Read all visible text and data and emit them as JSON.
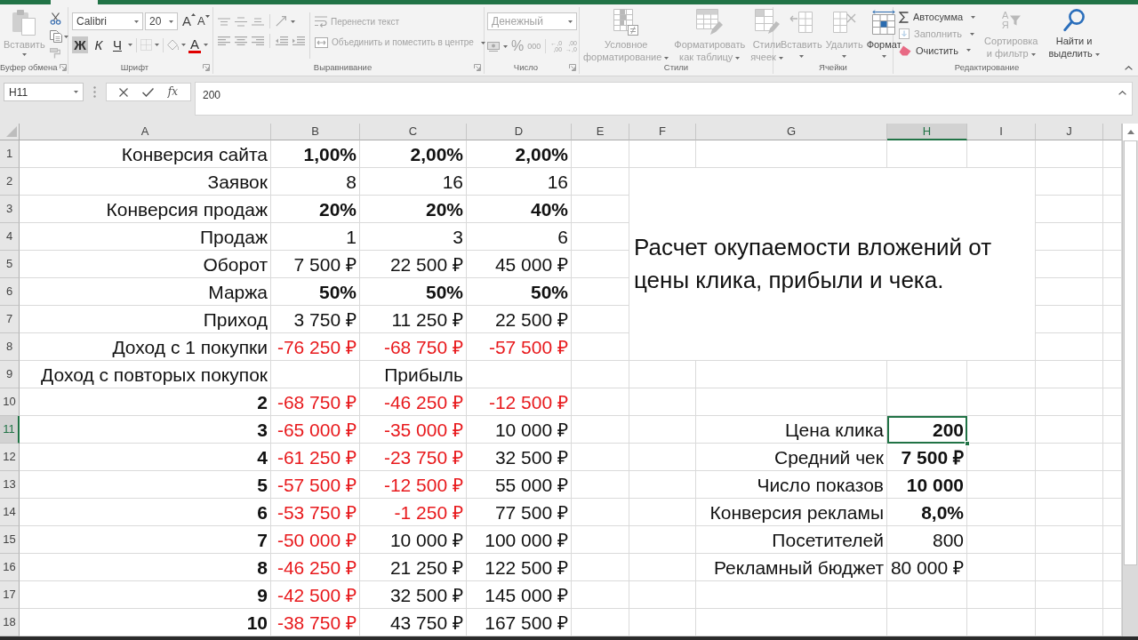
{
  "ribbon": {
    "clipboard": {
      "label": "Буфер обмена",
      "paste": {
        "label": "Вставить",
        "disabled": true
      }
    },
    "font": {
      "label": "Шрифт",
      "font_name": "Calibri",
      "font_size": "20",
      "grow_font": "A",
      "shrink_font": "A",
      "styles": [
        {
          "kind": "bold",
          "label": "Ж",
          "selected": true
        },
        {
          "kind": "italic",
          "label": "К",
          "selected": false
        },
        {
          "kind": "underline",
          "label": "Ч",
          "selected": false
        }
      ],
      "font_color": "A"
    },
    "alignment": {
      "label": "Выравнивание",
      "wrap_text": {
        "label": "Перенести текст",
        "disabled": true
      },
      "merge": {
        "label": "Объединить и поместить в центре",
        "disabled": true
      }
    },
    "number": {
      "label": "Число",
      "format": {
        "value": "Денежный",
        "disabled": true
      },
      "percent": "%",
      "thousands": "000",
      "increase_decimal": [
        "←,0",
        ",00"
      ],
      "decrease_decimal": [
        ",00",
        "→,0"
      ]
    },
    "styles": {
      "label": "Стили",
      "buttons": [
        {
          "kind": "conditional",
          "lines": [
            "Условное",
            "форматирование"
          ],
          "disabled": true
        },
        {
          "kind": "table",
          "lines": [
            "Форматировать",
            "как таблицу"
          ],
          "disabled": true
        },
        {
          "kind": "styles",
          "lines": [
            "Стили",
            "ячеек"
          ],
          "disabled": true
        }
      ]
    },
    "cells": {
      "label": "Ячейки",
      "buttons": [
        {
          "kind": "insert",
          "lines": [
            "Вставить"
          ],
          "disabled": true
        },
        {
          "kind": "delete",
          "lines": [
            "Удалить"
          ],
          "disabled": true
        },
        {
          "kind": "format",
          "lines": [
            "Формат"
          ],
          "disabled": false
        }
      ]
    },
    "editing": {
      "label": "Редактирование",
      "small_buttons": [
        {
          "kind": "autosum",
          "label": "Автосумма",
          "disabled": false
        },
        {
          "kind": "fill",
          "label": "Заполнить",
          "disabled": true
        },
        {
          "kind": "clear",
          "label": "Очистить",
          "disabled": false
        }
      ],
      "buttons": [
        {
          "kind": "sort",
          "glyphs": [
            "А",
            "Я"
          ],
          "lines": [
            "Сортировка",
            "и фильтр"
          ],
          "disabled": true
        },
        {
          "kind": "find",
          "lines": [
            "Найти и",
            "выделить"
          ],
          "disabled": false
        }
      ]
    }
  },
  "formula_bar": {
    "name_box": "H11",
    "function_label": "fx",
    "value": "200"
  },
  "sheet": {
    "columns": [
      {
        "label": "A",
        "selected": false
      },
      {
        "label": "B",
        "selected": false
      },
      {
        "label": "C",
        "selected": false
      },
      {
        "label": "D",
        "selected": false
      },
      {
        "label": "E",
        "selected": false
      },
      {
        "label": "F",
        "selected": false
      },
      {
        "label": "G",
        "selected": false
      },
      {
        "label": "H",
        "selected": true
      },
      {
        "label": "I",
        "selected": false
      },
      {
        "label": "J",
        "selected": false
      }
    ],
    "rows": [
      {
        "label": "1",
        "selected": false
      },
      {
        "label": "2",
        "selected": false
      },
      {
        "label": "3",
        "selected": false
      },
      {
        "label": "4",
        "selected": false
      },
      {
        "label": "5",
        "selected": false
      },
      {
        "label": "6",
        "selected": false
      },
      {
        "label": "7",
        "selected": false
      },
      {
        "label": "8",
        "selected": false
      },
      {
        "label": "9",
        "selected": false
      },
      {
        "label": "10",
        "selected": false
      },
      {
        "label": "11",
        "selected": true
      },
      {
        "label": "12",
        "selected": false
      },
      {
        "label": "13",
        "selected": false
      },
      {
        "label": "14",
        "selected": false
      },
      {
        "label": "15",
        "selected": false
      },
      {
        "label": "16",
        "selected": false
      },
      {
        "label": "17",
        "selected": false
      },
      {
        "label": "18",
        "selected": false
      }
    ],
    "calc_table": [
      {
        "name": {
          "text": "Конверсия сайта",
          "bold": false,
          "negative": false,
          "selected": false
        },
        "values": [
          {
            "text": "1,00%",
            "bold": true,
            "negative": false,
            "selected": false
          },
          {
            "text": "2,00%",
            "bold": true,
            "negative": false,
            "selected": false
          },
          {
            "text": "2,00%",
            "bold": true,
            "negative": false,
            "selected": false
          }
        ]
      },
      {
        "name": {
          "text": "Заявок",
          "bold": false,
          "negative": false,
          "selected": false
        },
        "values": [
          {
            "text": "8",
            "bold": false,
            "negative": false,
            "selected": false
          },
          {
            "text": "16",
            "bold": false,
            "negative": false,
            "selected": false
          },
          {
            "text": "16",
            "bold": false,
            "negative": false,
            "selected": false
          }
        ]
      },
      {
        "name": {
          "text": "Конверсия продаж",
          "bold": false,
          "negative": false,
          "selected": false
        },
        "values": [
          {
            "text": "20%",
            "bold": true,
            "negative": false,
            "selected": false
          },
          {
            "text": "20%",
            "bold": true,
            "negative": false,
            "selected": false
          },
          {
            "text": "40%",
            "bold": true,
            "negative": false,
            "selected": false
          }
        ]
      },
      {
        "name": {
          "text": "Продаж",
          "bold": false,
          "negative": false,
          "selected": false
        },
        "values": [
          {
            "text": "1",
            "bold": false,
            "negative": false,
            "selected": false
          },
          {
            "text": "3",
            "bold": false,
            "negative": false,
            "selected": false
          },
          {
            "text": "6",
            "bold": false,
            "negative": false,
            "selected": false
          }
        ]
      },
      {
        "name": {
          "text": "Оборот",
          "bold": false,
          "negative": false,
          "selected": false
        },
        "values": [
          {
            "text": "7 500 ₽",
            "bold": false,
            "negative": false,
            "selected": false
          },
          {
            "text": "22 500 ₽",
            "bold": false,
            "negative": false,
            "selected": false
          },
          {
            "text": "45 000 ₽",
            "bold": false,
            "negative": false,
            "selected": false
          }
        ]
      },
      {
        "name": {
          "text": "Маржа",
          "bold": false,
          "negative": false,
          "selected": false
        },
        "values": [
          {
            "text": "50%",
            "bold": true,
            "negative": false,
            "selected": false
          },
          {
            "text": "50%",
            "bold": true,
            "negative": false,
            "selected": false
          },
          {
            "text": "50%",
            "bold": true,
            "negative": false,
            "selected": false
          }
        ]
      },
      {
        "name": {
          "text": "Приход",
          "bold": false,
          "negative": false,
          "selected": false
        },
        "values": [
          {
            "text": "3 750 ₽",
            "bold": false,
            "negative": false,
            "selected": false
          },
          {
            "text": "11 250 ₽",
            "bold": false,
            "negative": false,
            "selected": false
          },
          {
            "text": "22 500 ₽",
            "bold": false,
            "negative": false,
            "selected": false
          }
        ]
      },
      {
        "name": {
          "text": "Доход с 1 покупки",
          "bold": false,
          "negative": false,
          "selected": false
        },
        "values": [
          {
            "text": "-76 250 ₽",
            "bold": false,
            "negative": true,
            "selected": false
          },
          {
            "text": "-68 750 ₽",
            "bold": false,
            "negative": true,
            "selected": false
          },
          {
            "text": "-57 500 ₽",
            "bold": false,
            "negative": true,
            "selected": false
          }
        ]
      },
      {
        "name": {
          "text": "Доход с повторых покупок",
          "bold": false,
          "negative": false,
          "selected": false
        },
        "heading": {
          "text": "Прибыль",
          "bold": false,
          "negative": false,
          "selected": false
        }
      },
      {
        "name": {
          "text": "2",
          "bold": true,
          "negative": false,
          "selected": false
        },
        "values": [
          {
            "text": "-68 750 ₽",
            "bold": false,
            "negative": true,
            "selected": false
          },
          {
            "text": "-46 250 ₽",
            "bold": false,
            "negative": true,
            "selected": false
          },
          {
            "text": "-12 500 ₽",
            "bold": false,
            "negative": true,
            "selected": false
          }
        ]
      },
      {
        "name": {
          "text": "3",
          "bold": true,
          "negative": false,
          "selected": false
        },
        "values": [
          {
            "text": "-65 000 ₽",
            "bold": false,
            "negative": true,
            "selected": false
          },
          {
            "text": "-35 000 ₽",
            "bold": false,
            "negative": true,
            "selected": false
          },
          {
            "text": "10 000 ₽",
            "bold": false,
            "negative": false,
            "selected": false
          }
        ]
      },
      {
        "name": {
          "text": "4",
          "bold": true,
          "negative": false,
          "selected": false
        },
        "values": [
          {
            "text": "-61 250 ₽",
            "bold": false,
            "negative": true,
            "selected": false
          },
          {
            "text": "-23 750 ₽",
            "bold": false,
            "negative": true,
            "selected": false
          },
          {
            "text": "32 500 ₽",
            "bold": false,
            "negative": false,
            "selected": false
          }
        ]
      },
      {
        "name": {
          "text": "5",
          "bold": true,
          "negative": false,
          "selected": false
        },
        "values": [
          {
            "text": "-57 500 ₽",
            "bold": false,
            "negative": true,
            "selected": false
          },
          {
            "text": "-12 500 ₽",
            "bold": false,
            "negative": true,
            "selected": false
          },
          {
            "text": "55 000 ₽",
            "bold": false,
            "negative": false,
            "selected": false
          }
        ]
      },
      {
        "name": {
          "text": "6",
          "bold": true,
          "negative": false,
          "selected": false
        },
        "values": [
          {
            "text": "-53 750 ₽",
            "bold": false,
            "negative": true,
            "selected": false
          },
          {
            "text": "-1 250 ₽",
            "bold": false,
            "negative": true,
            "selected": false
          },
          {
            "text": "77 500 ₽",
            "bold": false,
            "negative": false,
            "selected": false
          }
        ]
      },
      {
        "name": {
          "text": "7",
          "bold": true,
          "negative": false,
          "selected": false
        },
        "values": [
          {
            "text": "-50 000 ₽",
            "bold": false,
            "negative": true,
            "selected": false
          },
          {
            "text": "10 000 ₽",
            "bold": false,
            "negative": false,
            "selected": false
          },
          {
            "text": "100 000 ₽",
            "bold": false,
            "negative": false,
            "selected": false
          }
        ]
      },
      {
        "name": {
          "text": "8",
          "bold": true,
          "negative": false,
          "selected": false
        },
        "values": [
          {
            "text": "-46 250 ₽",
            "bold": false,
            "negative": true,
            "selected": false
          },
          {
            "text": "21 250 ₽",
            "bold": false,
            "negative": false,
            "selected": false
          },
          {
            "text": "122 500 ₽",
            "bold": false,
            "negative": false,
            "selected": false
          }
        ]
      },
      {
        "name": {
          "text": "9",
          "bold": true,
          "negative": false,
          "selected": false
        },
        "values": [
          {
            "text": "-42 500 ₽",
            "bold": false,
            "negative": true,
            "selected": false
          },
          {
            "text": "32 500 ₽",
            "bold": false,
            "negative": false,
            "selected": false
          },
          {
            "text": "145 000 ₽",
            "bold": false,
            "negative": false,
            "selected": false
          }
        ]
      },
      {
        "name": {
          "text": "10",
          "bold": true,
          "negative": false,
          "selected": false
        },
        "values": [
          {
            "text": "-38 750 ₽",
            "bold": false,
            "negative": true,
            "selected": false
          },
          {
            "text": "43 750 ₽",
            "bold": false,
            "negative": false,
            "selected": false
          },
          {
            "text": "167 500 ₽",
            "bold": false,
            "negative": false,
            "selected": false
          }
        ]
      }
    ],
    "parameters": [
      {
        "name": {
          "text": "Цена клика",
          "bold": false,
          "negative": false,
          "selected": false
        },
        "value": {
          "text": "200",
          "bold": true,
          "negative": false,
          "selected": true
        }
      },
      {
        "name": {
          "text": "Средний чек",
          "bold": false,
          "negative": false,
          "selected": false
        },
        "value": {
          "text": "7 500 ₽",
          "bold": true,
          "negative": false,
          "selected": false
        }
      },
      {
        "name": {
          "text": "Число показов",
          "bold": false,
          "negative": false,
          "selected": false
        },
        "value": {
          "text": "10 000",
          "bold": true,
          "negative": false,
          "selected": false
        }
      },
      {
        "name": {
          "text": "Конверсия рекламы",
          "bold": false,
          "negative": false,
          "selected": false
        },
        "value": {
          "text": "8,0%",
          "bold": true,
          "negative": false,
          "selected": false
        }
      },
      {
        "name": {
          "text": "Посетителей",
          "bold": false,
          "negative": false,
          "selected": false
        },
        "value": {
          "text": "800",
          "bold": false,
          "negative": false,
          "selected": false
        }
      },
      {
        "name": {
          "text": "Рекламный бюджет",
          "bold": false,
          "negative": false,
          "selected": false
        },
        "value": {
          "text": "80 000 ₽",
          "bold": false,
          "negative": false,
          "selected": false
        }
      }
    ],
    "text_box": "Расчет окупаемости вложений от цены клика, прибыли и чека."
  }
}
